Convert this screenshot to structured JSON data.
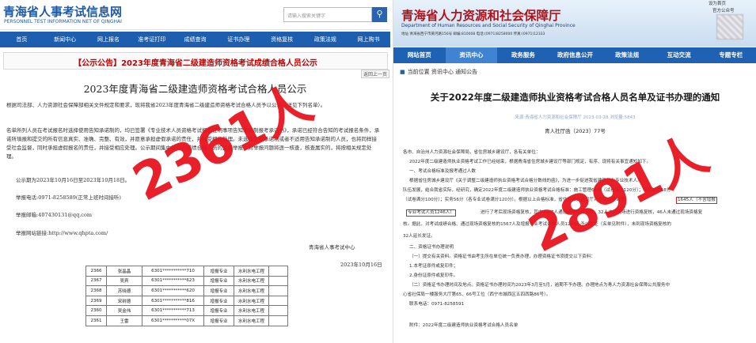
{
  "left": {
    "site_title": "青海省人事考试信息网",
    "site_subtitle": "PERSONNEL TEST INFORMATION NET OF QINGHAI",
    "search_placeholder": "请输入搜索关键字",
    "nav": [
      "首页",
      "新闻中心",
      "网上报名",
      "准考证打印",
      "成绩查询",
      "证书办理",
      "资格复核",
      "政策法规",
      "网上购书"
    ],
    "notice_heading": "【公示公告】2023年度青海省二级建造师资格考试成绩合格人员公示",
    "back_label": "返回上一页",
    "doc_title": "2023年度青海省二级建造师资格考试合格人员公示",
    "para1": "根据司法部、人力资源社会保障部相关文件规定和要求，现将我省2023年度青海省二级建造师资格考试合格人员予以公示（详见下列名单）。",
    "para2": "名单所列人员在考试报名时选择使用告知承诺制的，均已签署《专业技术人员资格考试报名证明事项告知承诺制报考承诺书》，承诺已经符合告知的考试报名条件，承诺所填报和提交的所有信息真实、准确、完整、有效，并愿意承担虚假承诺的责任，并接受相应处理。未选择告知承诺制或者不适用告知承诺制的人员，也将同样接受社会监督，同时承担虚假报名的责任，并接受相应处理。公示期间集中接受对成绩合格人员的监督举报，对举报问题将逐一核查，核查属实的，将按相关规定处理。",
    "period": "公示期为2023年10月16日至2023年10月18日。",
    "phone": "举报电话:0971-8258589(正常上班时间接听)",
    "email": "举报邮箱:407430131@qq.com",
    "mail_addr": "举报地址:",
    "website": "举报网站链接:http://www.qhpta.com/",
    "signature": "青海省人事考试中心",
    "date": "2023年10月16日",
    "table_rows": [
      [
        "2366",
        "张晶晶",
        "6301***********710",
        "增报专业",
        "水利水电工程"
      ],
      [
        "2367",
        "吴宾",
        "6301***********623",
        "增报专业",
        "水利水电工程"
      ],
      [
        "2368",
        "苏晓德",
        "6301***********620",
        "增报专业",
        "水利水电工程"
      ],
      [
        "2369",
        "宋树德",
        "6301***********816",
        "增报专业",
        "水利水电工程"
      ],
      [
        "2360",
        "吴金伟",
        "6301***********713",
        "增报专业",
        "水利水电工程"
      ],
      [
        "2361",
        "王雷",
        "6301***********07X",
        "增报专业",
        "水利水电工程"
      ]
    ],
    "overlay_count": "2361人"
  },
  "right": {
    "site_title": "青海省人力资源和社会保障厅",
    "site_subtitle": "Department of Human Resources and Social Security of Qinghai Province",
    "contact": "地址:青海省西宁市黄河路156号  邮编:810008  电话:(0971)8258000  传真:(0971)12333",
    "top_links": "设为首页",
    "wechat_label": "官方公众号",
    "nav": [
      "网站首页",
      "资讯中心",
      "政务服务",
      "政府信息公开",
      "政策法规",
      "互动交流",
      "专题专栏"
    ],
    "breadcrumb": "当前位置 资讯中心 通知公告",
    "article_title": "关于2022年度二级建造师执业资格考试合格人员名单及证书办理的通知",
    "meta": "来源:青海省人力资源和社会保障厅  2023-03-28  浏览量:5843",
    "doc_number": "青人社厅函〔2023〕77号",
    "body_lines": [
      "各市、自治州人力资源社会保障局，省住房城乡建设厅，各有关单位：",
      "2022年度二级建造师执业资格考试工作已经结束，根据青海省住房城乡建设厅等部门规定，有序、现将有关事宜通知如下。",
      "一、考试合格标准及报考通过人数",
      "根据省住房城乡建设厅《关于调整二级建造师执业资格考试合格分数线的函》，为进一步促进我省建筑行业专业技术人才",
      "队伍发展，结合我省实际，经研究，确定2022年度二级建造师执业资格考试合格标准：施工管理66分（试卷满分120分）；相关知识58分",
      "（试卷满分100分）；实务56分（各专业试卷满分120分）。根据以上合格标准，省住房城乡建设厅对考试成绩合格",
      "进行了考后现场资格复核，其中1567人通过现场资格复核，32人未到现场进行资格复核，46人未通过现场资格复",
      "核。据此，对考试成绩合格、通过现场资格复核的1567人及增报专业考试合格人员1246人予以发证（名单见附件），未到现场资格复核的",
      "32人延长发证。",
      "二、资格证书办理说明",
      "（一）提交有关资料。资格证书由考生所在单位统一负责办理，办理资格证书须提交以下资料：",
      "1.本考证原件或复印件；",
      "2.身份证原件或复印件。",
      "（二）资格证书办理时间及地点。资格证书办理时间为2023年3月至5月，逾期不予办理。办理地点为青人力资源社会保障公共服务中",
      "心省社保局一楼服务大厅第65、66号工位（西宁市城西区五四西路86号）。",
      "联系电话：0971-8258591",
      "附件：2022年度二级建造师执业资格考试合格人员名单"
    ],
    "highlight_1": "1645人（不含增报",
    "highlight_2": "专业考试人员1246人）",
    "overlay_count": "2891人"
  }
}
